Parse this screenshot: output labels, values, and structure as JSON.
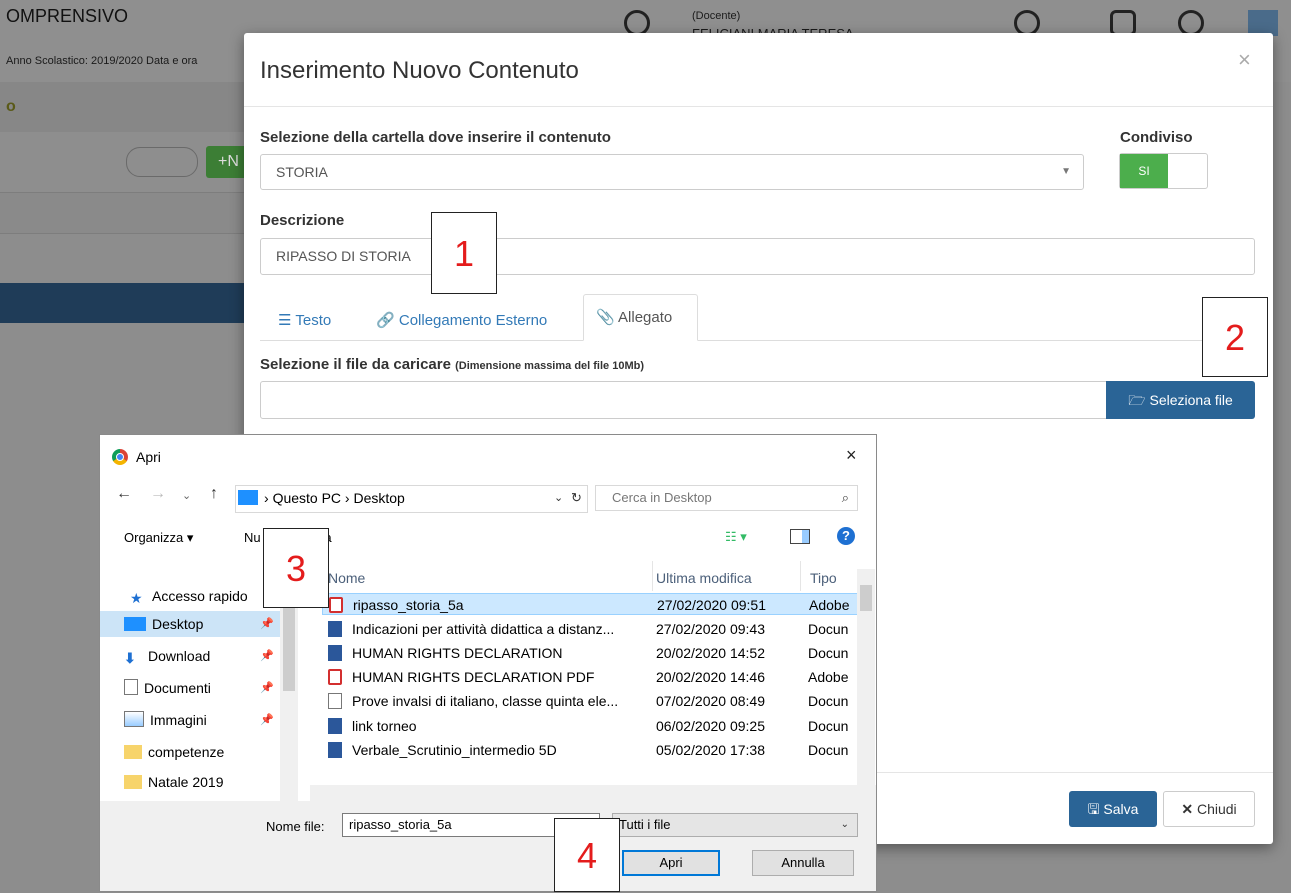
{
  "background": {
    "school_title": "OMPRENSIVO",
    "school_year": "Anno Scolastico: 2019/2020   Data e ora",
    "role": "(Docente)",
    "teacher_name": "FELICIANI MARIA TERESA",
    "menu_letter": "o",
    "new_button": "+N"
  },
  "modal": {
    "title": "Inserimento Nuovo Contenuto",
    "close": "×",
    "folder_label": "Selezione della cartella dove inserire il contenuto",
    "folder_value": "STORIA",
    "shared_label": "Condiviso",
    "shared_toggle": "SI",
    "description_label": "Descrizione",
    "description_value": "RIPASSO DI STORIA",
    "tabs": [
      {
        "label": "Testo",
        "icon": "align-left-icon"
      },
      {
        "label": "Collegamento Esterno",
        "icon": "link-icon"
      },
      {
        "label": "Allegato",
        "icon": "paperclip-icon"
      }
    ],
    "file_label": "Selezione il file da caricare",
    "file_hint": "(Dimensione massima del file 10Mb)",
    "select_file_button": "Seleziona file",
    "save_button": "Salva",
    "close_button": "Chiudi"
  },
  "callouts": [
    "1",
    "2",
    "3",
    "4"
  ],
  "dialog": {
    "title": "Apri",
    "close": "×",
    "path": "Questo PC  ›  Desktop",
    "path_prefix": "›",
    "search_placeholder": "Cerca in Desktop",
    "organize": "Organizza ▾",
    "new_folder": "Nuova cartella",
    "new_folder_visible_start": "Nu",
    "new_folder_visible_end": "lla",
    "columns": {
      "name": "Nome",
      "modified": "Ultima modifica",
      "type": "Tipo"
    },
    "nav": [
      {
        "label": "Accesso rapido",
        "icon": "star-icon"
      },
      {
        "label": "Desktop",
        "icon": "desktop-icon"
      },
      {
        "label": "Download",
        "icon": "download-icon"
      },
      {
        "label": "Documenti",
        "icon": "documents-icon"
      },
      {
        "label": "Immagini",
        "icon": "pictures-icon"
      },
      {
        "label": "competenze",
        "icon": "folder-icon"
      },
      {
        "label": "Natale 2019",
        "icon": "folder-icon"
      }
    ],
    "files": [
      {
        "name": "ripasso_storia_5a",
        "modified": "27/02/2020 09:51",
        "type": "Adobe",
        "icon": "pdf"
      },
      {
        "name": "Indicazioni per attività didattica a distanz...",
        "modified": "27/02/2020 09:43",
        "type": "Docun",
        "icon": "word"
      },
      {
        "name": "HUMAN RIGHTS DECLARATION",
        "modified": "20/02/2020 14:52",
        "type": "Docun",
        "icon": "word"
      },
      {
        "name": "HUMAN RIGHTS DECLARATION PDF",
        "modified": "20/02/2020 14:46",
        "type": "Adobe",
        "icon": "pdf"
      },
      {
        "name": "Prove invalsi di italiano, classe quinta ele...",
        "modified": "07/02/2020 08:49",
        "type": "Docun",
        "icon": "txt"
      },
      {
        "name": "link torneo",
        "modified": "06/02/2020 09:25",
        "type": "Docun",
        "icon": "word"
      },
      {
        "name": "Verbale_Scrutinio_intermedio 5D",
        "modified": "05/02/2020 17:38",
        "type": "Docun",
        "icon": "word"
      }
    ],
    "filename_label": "Nome file:",
    "filename_value": "ripasso_storia_5a",
    "filetype_value": "Tutti i file",
    "open_button": "Apri",
    "cancel_button": "Annulla"
  }
}
